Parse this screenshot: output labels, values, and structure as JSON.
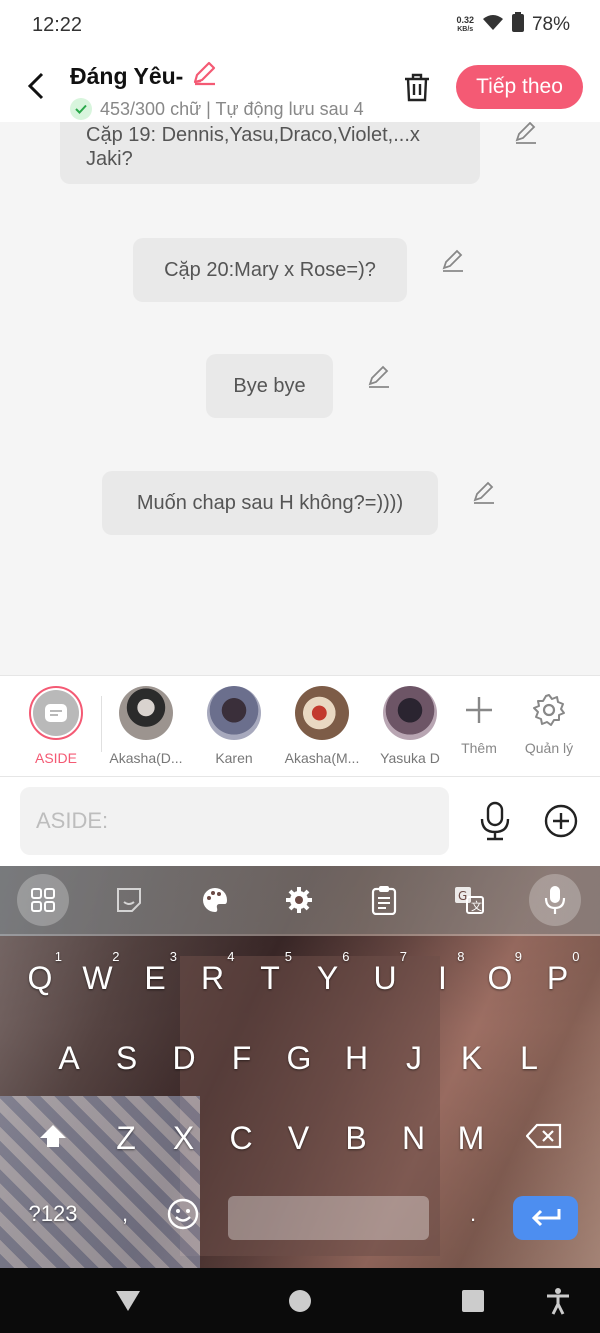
{
  "status": {
    "time": "12:22",
    "net_speed": "0.32",
    "net_unit": "KB/s",
    "battery": "78%"
  },
  "header": {
    "title": "Đáng Yêu-",
    "subtitle": "453/300 chữ | Tự động lưu sau 4",
    "next_label": "Tiếp theo"
  },
  "messages": [
    {
      "text": "Cặp 19: Dennis,Yasu,Draco,Violet,...x Jaki?"
    },
    {
      "text": "Cặp 20:Mary x Rose=)?"
    },
    {
      "text": "Bye bye"
    },
    {
      "text": "Muốn chap sau H không?=))))"
    }
  ],
  "characters": [
    {
      "name": "ASIDE",
      "active": true
    },
    {
      "name": "Akasha(D..."
    },
    {
      "name": "Karen"
    },
    {
      "name": "Akasha(M..."
    },
    {
      "name": "Yasuka D"
    }
  ],
  "tools": {
    "add_label": "Thêm",
    "manage_label": "Quản lý"
  },
  "input": {
    "placeholder": "ASIDE:"
  },
  "keyboard": {
    "row1": [
      "Q",
      "W",
      "E",
      "R",
      "T",
      "Y",
      "U",
      "I",
      "O",
      "P"
    ],
    "row1_hints": [
      "1",
      "2",
      "3",
      "4",
      "5",
      "6",
      "7",
      "8",
      "9",
      "0"
    ],
    "row2": [
      "A",
      "S",
      "D",
      "F",
      "G",
      "H",
      "J",
      "K",
      "L"
    ],
    "row3": [
      "Z",
      "X",
      "C",
      "V",
      "B",
      "N",
      "M"
    ],
    "symbols_label": "?123",
    "comma": ",",
    "period": "."
  },
  "colors": {
    "accent": "#f45a74",
    "enter": "#4d8ef0"
  }
}
